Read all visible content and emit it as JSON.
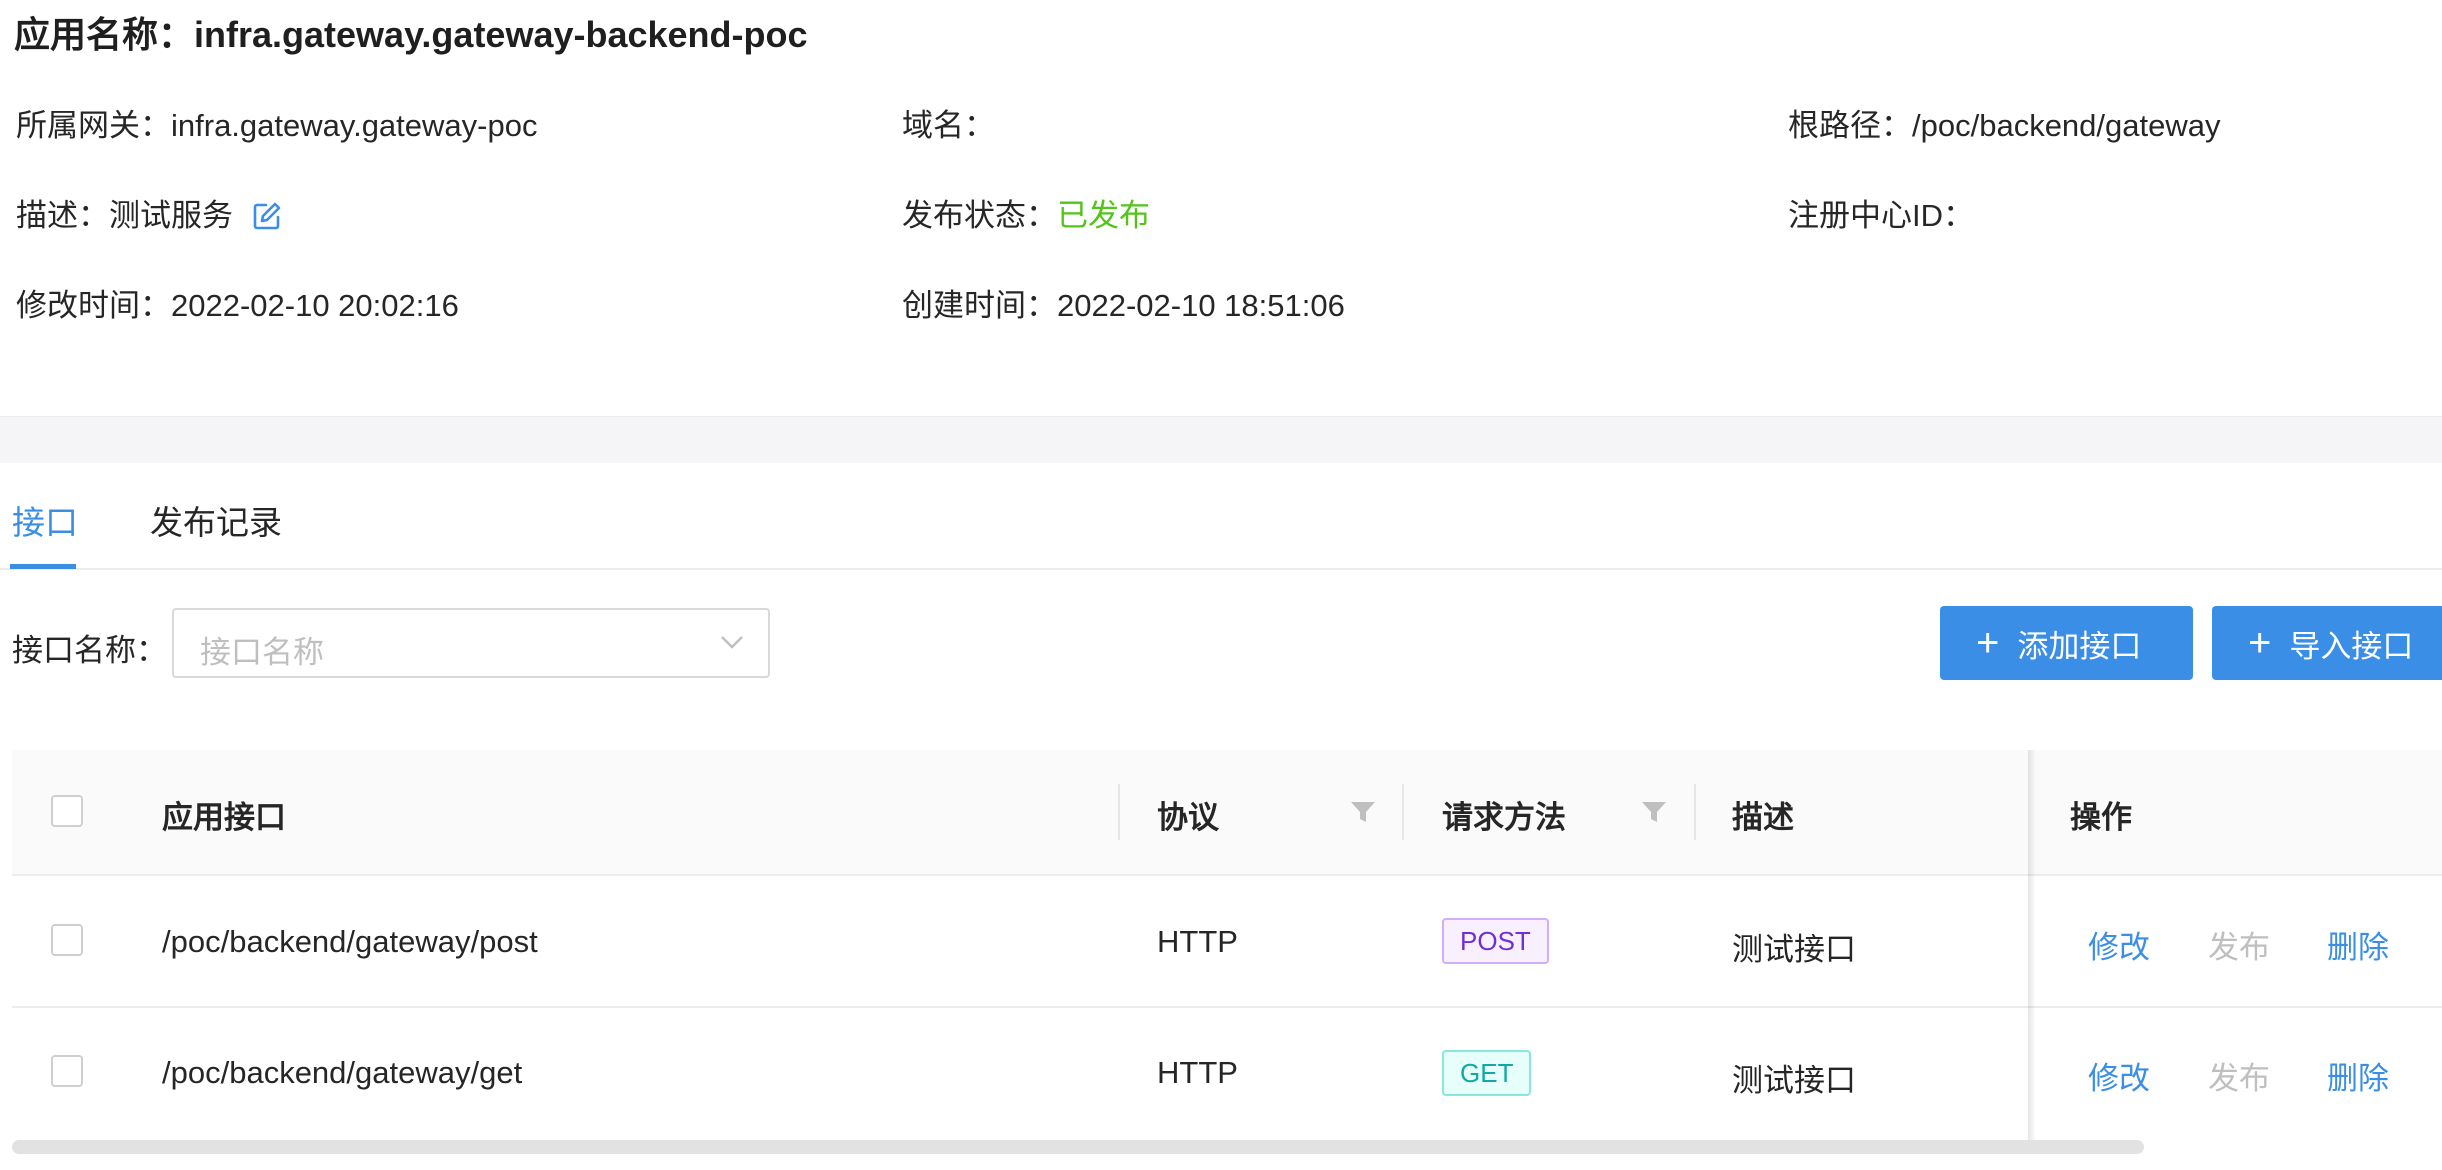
{
  "app": {
    "title_label": "应用名称：",
    "title_value": "infra.gateway.gateway-backend-poc"
  },
  "info": {
    "gateway_label": "所属网关：",
    "gateway_value": "infra.gateway.gateway-poc",
    "domain_label": "域名：",
    "domain_value": "",
    "root_path_label": "根路径：",
    "root_path_value": "/poc/backend/gateway",
    "desc_label": "描述：",
    "desc_value": "测试服务",
    "publish_status_label": "发布状态：",
    "publish_status_value": "已发布",
    "registry_label": "注册中心ID：",
    "registry_value": "",
    "modified_label": "修改时间：",
    "modified_value": "2022-02-10 20:02:16",
    "created_label": "创建时间：",
    "created_value": "2022-02-10 18:51:06"
  },
  "tabs": [
    {
      "label": "接口",
      "active": true
    },
    {
      "label": "发布记录",
      "active": false
    }
  ],
  "filter": {
    "label": "接口名称：",
    "placeholder": "接口名称"
  },
  "buttons": {
    "add": "添加接口",
    "import": "导入接口"
  },
  "table": {
    "columns": {
      "path": "应用接口",
      "protocol": "协议",
      "method": "请求方法",
      "description": "描述",
      "actions": "操作"
    },
    "rows": [
      {
        "path": "/poc/backend/gateway/post",
        "protocol": "HTTP",
        "method": "POST",
        "description": "测试接口",
        "edit": "修改",
        "publish": "发布",
        "delete": "删除"
      },
      {
        "path": "/poc/backend/gateway/get",
        "protocol": "HTTP",
        "method": "GET",
        "description": "测试接口",
        "edit": "修改",
        "publish": "发布",
        "delete": "删除"
      }
    ]
  },
  "colors": {
    "primary": "#3a8ee6",
    "success": "#52c41a",
    "post_tag": "#722ed1",
    "get_tag": "#13a8a8"
  }
}
